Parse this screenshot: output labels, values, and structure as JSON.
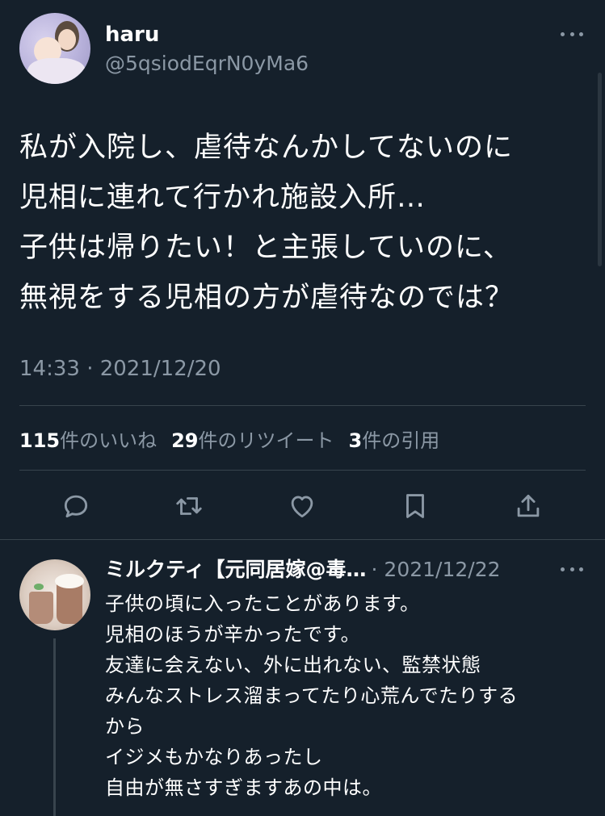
{
  "tweet": {
    "author": {
      "display_name": "haru",
      "handle": "@5qsiodEqrN0yMa6"
    },
    "text_lines": [
      "私が入院し、虐待なんかしてないのに",
      "児相に連れて行かれ施設入所…",
      "子供は帰りたい！と主張していのに、",
      "無視をする児相の方が虐待なのでは？"
    ],
    "timestamp": "14:33 · 2021/12/20",
    "stats": {
      "likes_count": "115",
      "likes_label": "件のいいね",
      "retweets_count": "29",
      "retweets_label": "件のリツイート",
      "quotes_count": "3",
      "quotes_label": "件の引用"
    },
    "actions": [
      "reply-icon",
      "retweet-icon",
      "like-icon",
      "bookmark-icon",
      "share-icon"
    ]
  },
  "reply": {
    "author_name": "ミルクティ【元同居嫁@毒…",
    "date": "· 2021/12/22",
    "text_lines": [
      "子供の頃に入ったことがあります。",
      "児相のほうが辛かったです。",
      "友達に会えない、外に出れない、監禁状態",
      "みんなストレス溜まってたり心荒んでたりする",
      "から",
      "イジメもかなりあったし",
      "自由が無さすぎますあの中は。"
    ]
  },
  "colors": {
    "background": "#15202b",
    "text": "#ffffff",
    "secondary_text": "#8b98a5",
    "divider": "#38444d"
  }
}
